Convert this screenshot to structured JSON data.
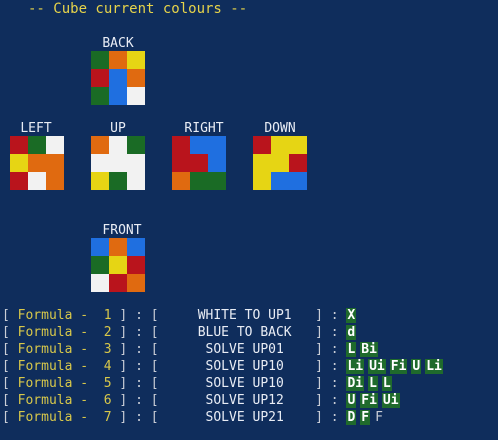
{
  "header": {
    "title": "-- Cube current colours --"
  },
  "colors": {
    "G": "#1a6b25",
    "O": "#e06a10",
    "Y": "#e6d514",
    "R": "#b9141c",
    "B": "#1f6fe0",
    "W": "#f2f2f2"
  },
  "faces": [
    {
      "name": "BACK",
      "cells": [
        "G",
        "O",
        "Y",
        "R",
        "B",
        "O",
        "G",
        "B",
        "W"
      ]
    },
    {
      "name": "LEFT",
      "cells": [
        "R",
        "G",
        "W",
        "Y",
        "O",
        "O",
        "R",
        "W",
        "O"
      ]
    },
    {
      "name": "UP",
      "cells": [
        "O",
        "W",
        "G",
        "W",
        "W",
        "W",
        "Y",
        "G",
        "W"
      ]
    },
    {
      "name": "RIGHT",
      "cells": [
        "R",
        "B",
        "B",
        "R",
        "R",
        "B",
        "O",
        "G",
        "G"
      ]
    },
    {
      "name": "DOWN",
      "cells": [
        "R",
        "Y",
        "Y",
        "Y",
        "Y",
        "R",
        "Y",
        "B",
        "B"
      ]
    },
    {
      "name": "FRONT",
      "cells": [
        "B",
        "O",
        "B",
        "G",
        "Y",
        "R",
        "W",
        "R",
        "O"
      ]
    }
  ],
  "formulas": [
    {
      "label": "Formula -",
      "num": "1",
      "desc": "WHITE TO UP1",
      "moves": [
        {
          "t": "X",
          "h": true
        }
      ]
    },
    {
      "label": "Formula -",
      "num": "2",
      "desc": "BLUE TO BACK",
      "moves": [
        {
          "t": "d",
          "h": true
        }
      ]
    },
    {
      "label": "Formula -",
      "num": "3",
      "desc": "SOLVE UP01",
      "moves": [
        {
          "t": "L",
          "h": true
        },
        {
          "t": "Bi",
          "h": true
        }
      ]
    },
    {
      "label": "Formula -",
      "num": "4",
      "desc": "SOLVE UP10",
      "moves": [
        {
          "t": "Li",
          "h": true
        },
        {
          "t": "Ui",
          "h": true
        },
        {
          "t": "Fi",
          "h": true
        },
        {
          "t": "U",
          "h": true
        },
        {
          "t": "Li",
          "h": true
        }
      ]
    },
    {
      "label": "Formula -",
      "num": "5",
      "desc": "SOLVE UP10",
      "moves": [
        {
          "t": "Di",
          "h": true
        },
        {
          "t": "L",
          "h": true
        },
        {
          "t": "L",
          "h": true
        }
      ]
    },
    {
      "label": "Formula -",
      "num": "6",
      "desc": "SOLVE UP12",
      "moves": [
        {
          "t": "U",
          "h": true
        },
        {
          "t": "Fi",
          "h": true
        },
        {
          "t": "Ui",
          "h": true
        }
      ]
    },
    {
      "label": "Formula -",
      "num": "7",
      "desc": "SOLVE UP21",
      "moves": [
        {
          "t": "D",
          "h": true
        },
        {
          "t": "F",
          "h": true
        },
        {
          "t": "F",
          "h": false
        }
      ]
    }
  ]
}
